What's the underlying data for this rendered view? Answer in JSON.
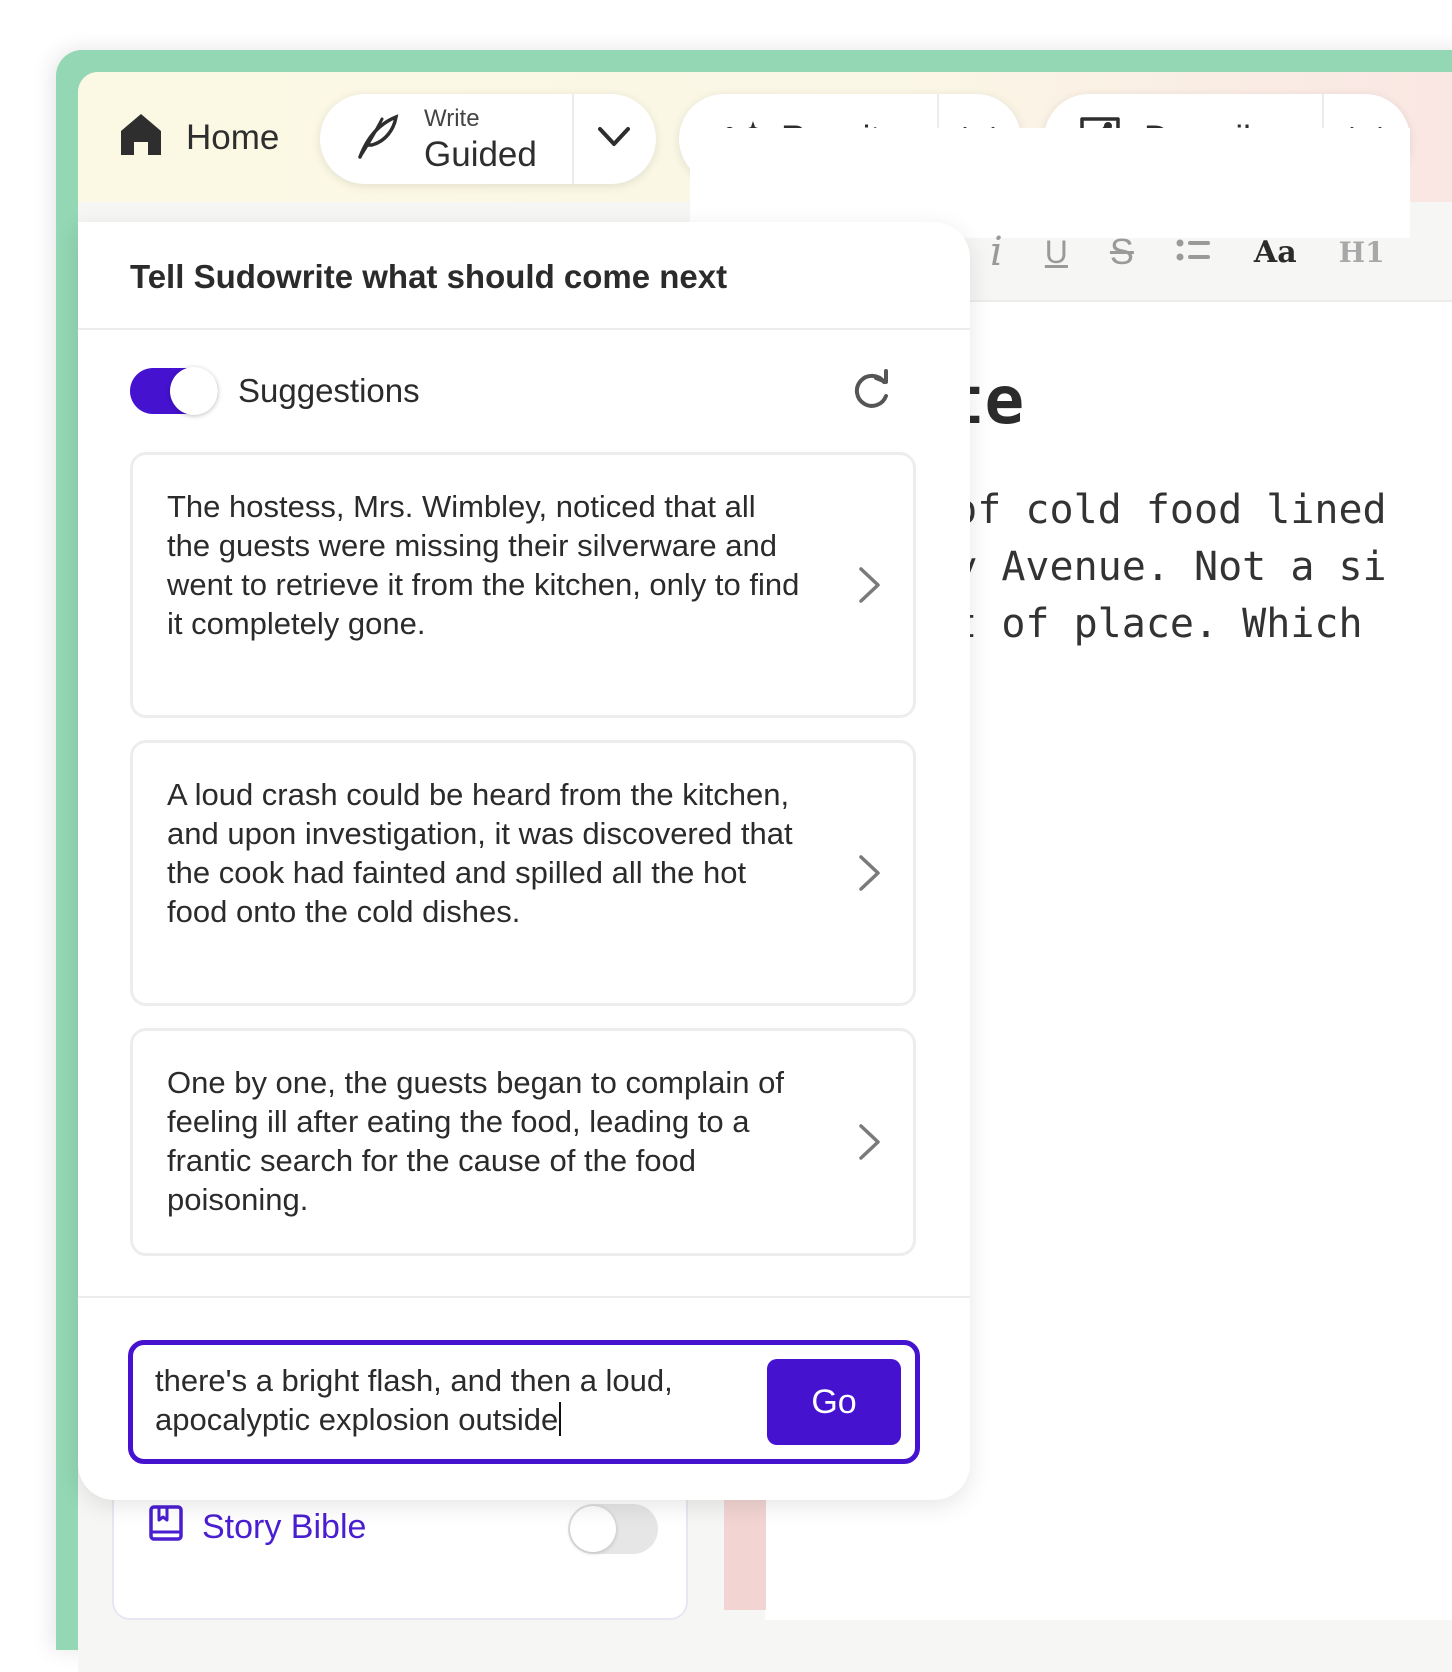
{
  "toolbar": {
    "home_label": "Home",
    "write": {
      "small_label": "Write",
      "main_label": "Guided"
    },
    "rewrite_label": "Rewrite",
    "describe_label": "Describe"
  },
  "format_bar": {
    "items": [
      "i",
      "U",
      "S",
      "Aa",
      "H1"
    ]
  },
  "editor": {
    "title_fragment": "ite",
    "body_lines": [
      "s of cold food lined",
      "ley Avenue. Not a si",
      "out of place. Which"
    ]
  },
  "popup": {
    "title": "Tell Sudowrite what should come next",
    "suggestions_label": "Suggestions",
    "suggestions_enabled": true,
    "suggestions": [
      "The hostess, Mrs. Wimbley, noticed that all the guests were missing their silverware and went to retrieve it from the kitchen, only to find it completely gone.",
      "A loud crash could be heard from the kitchen, and upon investigation, it was discovered that the cook had fainted and spilled all the hot food onto the cold dishes.",
      "One by one, the guests began to complain of feeling ill after eating the food, leading to a frantic search for the cause of the food poisoning."
    ],
    "input_value": "there's a bright flash, and then a loud, apocalyptic explosion outside",
    "go_label": "Go"
  },
  "sidebar": {
    "story_bible_label": "Story Bible",
    "story_bible_enabled": false
  },
  "colors": {
    "accent": "#4512d0",
    "frame_green": "#93d7b4",
    "toolbar_bg": "#fbf8e4"
  }
}
